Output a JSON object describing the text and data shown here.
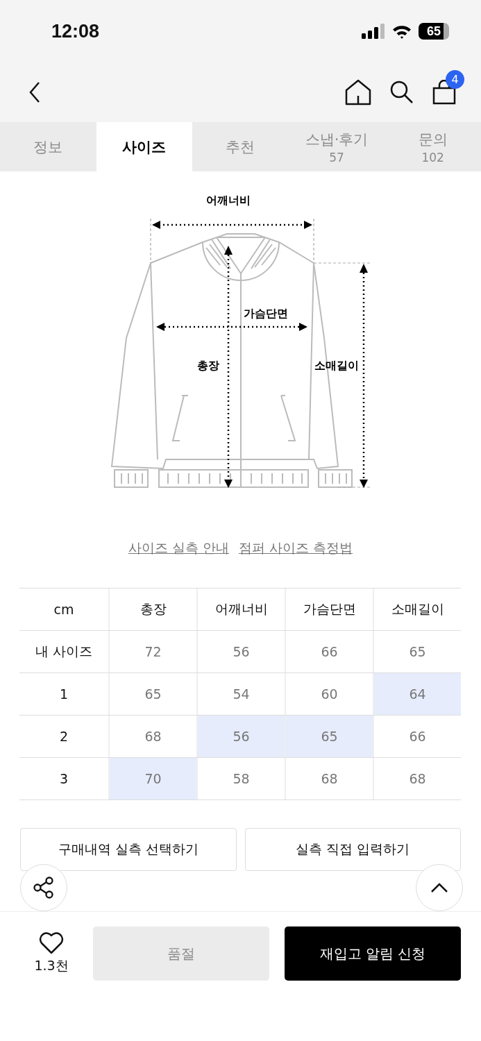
{
  "status_bar": {
    "time": "12:08",
    "battery": "65"
  },
  "nav": {
    "cart_count": "4"
  },
  "tabs": [
    {
      "label": "정보",
      "selected": false
    },
    {
      "label": "사이즈",
      "selected": true
    },
    {
      "label": "추천",
      "selected": false
    },
    {
      "label": "스냅·후기",
      "count": "57",
      "selected": false
    },
    {
      "label": "문의",
      "count": "102",
      "selected": false
    }
  ],
  "diagram": {
    "shoulder": "어깨너비",
    "chest": "가슴단면",
    "length": "총장",
    "sleeve": "소매길이"
  },
  "links": [
    "사이즈 실측 안내",
    "점퍼 사이즈 측정법"
  ],
  "table": {
    "columns": [
      "cm",
      "총장",
      "어깨너비",
      "가슴단면",
      "소매길이"
    ],
    "rows": [
      {
        "cells": [
          {
            "value": "내 사이즈",
            "highlighted": false
          },
          {
            "value": "72",
            "highlighted": false
          },
          {
            "value": "56",
            "highlighted": false
          },
          {
            "value": "66",
            "highlighted": false
          },
          {
            "value": "65",
            "highlighted": false
          }
        ]
      },
      {
        "cells": [
          {
            "value": "1",
            "highlighted": false
          },
          {
            "value": "65",
            "highlighted": false
          },
          {
            "value": "54",
            "highlighted": false
          },
          {
            "value": "60",
            "highlighted": false
          },
          {
            "value": "64",
            "highlighted": true
          }
        ]
      },
      {
        "cells": [
          {
            "value": "2",
            "highlighted": false
          },
          {
            "value": "68",
            "highlighted": false
          },
          {
            "value": "56",
            "highlighted": true
          },
          {
            "value": "65",
            "highlighted": true
          },
          {
            "value": "66",
            "highlighted": false
          }
        ]
      },
      {
        "cells": [
          {
            "value": "3",
            "highlighted": false
          },
          {
            "value": "70",
            "highlighted": true
          },
          {
            "value": "58",
            "highlighted": false
          },
          {
            "value": "68",
            "highlighted": false
          },
          {
            "value": "68",
            "highlighted": false
          }
        ]
      }
    ]
  },
  "actions": [
    "구매내역 실측 선택하기",
    "실측 직접 입력하기"
  ],
  "footer": {
    "likes": "1.3천",
    "sold_out": {
      "label": "품절",
      "disabled": true
    },
    "restock": "재입고 알림 신청"
  }
}
